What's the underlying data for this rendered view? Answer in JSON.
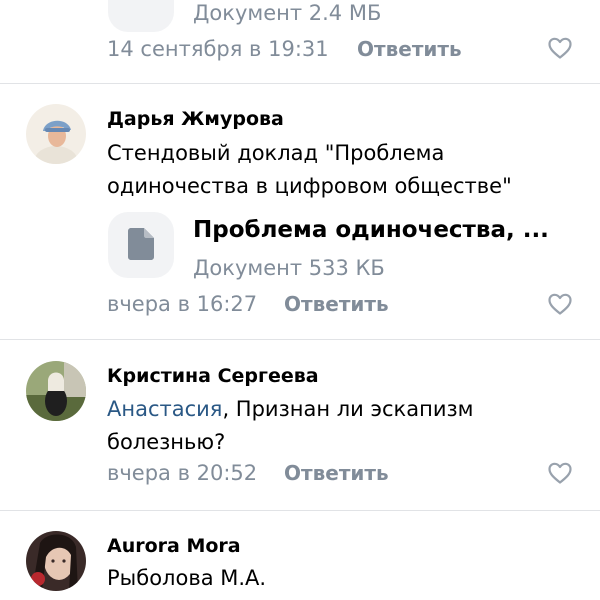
{
  "top_fragment": {
    "doc_meta": "Документ 2.4 МБ",
    "date": "14 сентября в 19:31",
    "reply_label": "Ответить"
  },
  "comments": [
    {
      "author": "Дарья Жмурова",
      "text": "Стендовый доклад \"Проблема одиночества в цифровом обществе\"",
      "attachment": {
        "name": "Проблема одиночества, ...",
        "meta": "Документ 533 КБ",
        "icon": "document-icon"
      },
      "date": "вчера в 16:27",
      "reply_label": "Ответить"
    },
    {
      "author": "Кристина Сергеева",
      "mention": "Анастасия",
      "text": ", Признан ли эскапизм болезнью?",
      "date": "вчера в 20:52",
      "reply_label": "Ответить"
    },
    {
      "author": "Aurora Mora",
      "text": "Рыболова М.А."
    }
  ],
  "colors": {
    "secondary_text": "#818c99",
    "link": "#2a5885",
    "divider": "#e1e3e6",
    "icon_background": "#f2f3f5",
    "like_icon": "#99a2ad"
  }
}
